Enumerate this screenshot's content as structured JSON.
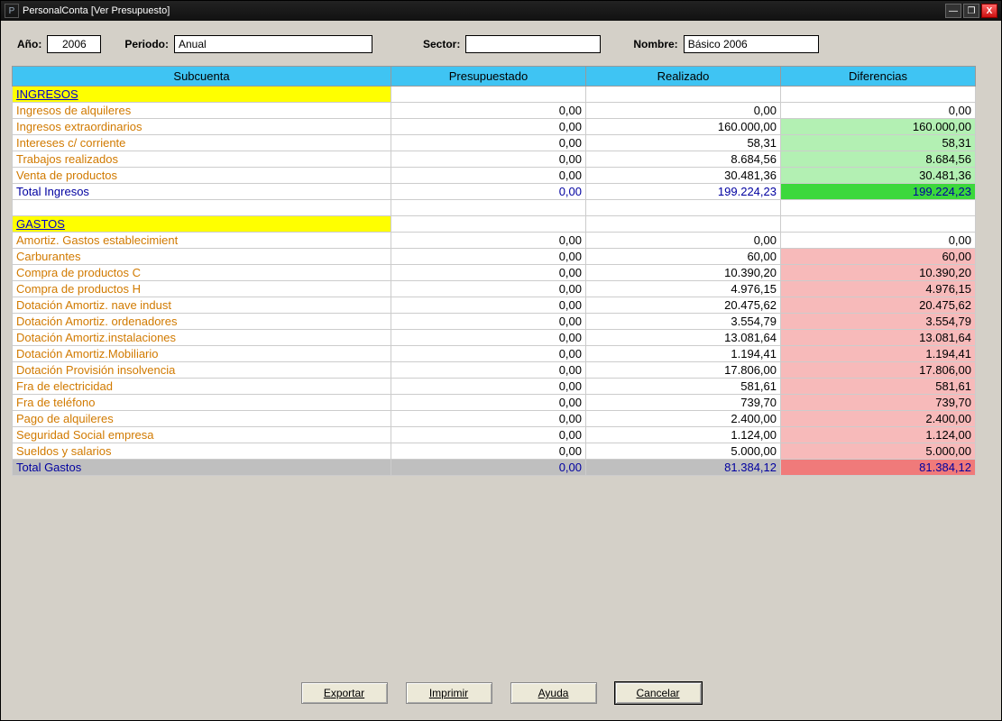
{
  "window": {
    "title": "PersonalConta [Ver Presupuesto]"
  },
  "filters": {
    "ano_label": "Año:",
    "ano_value": "2006",
    "periodo_label": "Periodo:",
    "periodo_value": "Anual",
    "sector_label": "Sector:",
    "sector_value": "",
    "nombre_label": "Nombre:",
    "nombre_value": "Básico 2006"
  },
  "columns": {
    "subcuenta": "Subcuenta",
    "presupuestado": "Presupuestado",
    "realizado": "Realizado",
    "diferencias": "Diferencias"
  },
  "sections": [
    {
      "header": "INGRESOS",
      "rows": [
        {
          "label": "Ingresos de alquileres",
          "pres": "0,00",
          "real": "0,00",
          "diff": "0,00",
          "diff_class": ""
        },
        {
          "label": "Ingresos extraordinarios",
          "pres": "0,00",
          "real": "160.000,00",
          "diff": "160.000,00",
          "diff_class": "bg-lightgreen"
        },
        {
          "label": "Intereses c/ corriente",
          "pres": "0,00",
          "real": "58,31",
          "diff": "58,31",
          "diff_class": "bg-lightgreen"
        },
        {
          "label": "Trabajos realizados",
          "pres": "0,00",
          "real": "8.684,56",
          "diff": "8.684,56",
          "diff_class": "bg-lightgreen"
        },
        {
          "label": "Venta de productos",
          "pres": "0,00",
          "real": "30.481,36",
          "diff": "30.481,36",
          "diff_class": "bg-lightgreen"
        }
      ],
      "total": {
        "label": "Total Ingresos",
        "pres": "0,00",
        "real": "199.224,23",
        "diff": "199.224,23",
        "row_class": "",
        "diff_class": "bg-green",
        "text_class": "navy"
      }
    },
    {
      "header": "GASTOS",
      "rows": [
        {
          "label": "Amortiz. Gastos establecimient",
          "pres": "0,00",
          "real": "0,00",
          "diff": "0,00",
          "diff_class": ""
        },
        {
          "label": "Carburantes",
          "pres": "0,00",
          "real": "60,00",
          "diff": "60,00",
          "diff_class": "bg-pink"
        },
        {
          "label": "Compra de productos C",
          "pres": "0,00",
          "real": "10.390,20",
          "diff": "10.390,20",
          "diff_class": "bg-pink"
        },
        {
          "label": "Compra de productos H",
          "pres": "0,00",
          "real": "4.976,15",
          "diff": "4.976,15",
          "diff_class": "bg-pink"
        },
        {
          "label": "Dotación Amortiz. nave indust",
          "pres": "0,00",
          "real": "20.475,62",
          "diff": "20.475,62",
          "diff_class": "bg-pink"
        },
        {
          "label": "Dotación Amortiz. ordenadores",
          "pres": "0,00",
          "real": "3.554,79",
          "diff": "3.554,79",
          "diff_class": "bg-pink"
        },
        {
          "label": "Dotación Amortiz.instalaciones",
          "pres": "0,00",
          "real": "13.081,64",
          "diff": "13.081,64",
          "diff_class": "bg-pink"
        },
        {
          "label": "Dotación Amortiz.Mobiliario",
          "pres": "0,00",
          "real": "1.194,41",
          "diff": "1.194,41",
          "diff_class": "bg-pink"
        },
        {
          "label": "Dotación Provisión insolvencia",
          "pres": "0,00",
          "real": "17.806,00",
          "diff": "17.806,00",
          "diff_class": "bg-pink"
        },
        {
          "label": "Fra de electricidad",
          "pres": "0,00",
          "real": "581,61",
          "diff": "581,61",
          "diff_class": "bg-pink"
        },
        {
          "label": "Fra de teléfono",
          "pres": "0,00",
          "real": "739,70",
          "diff": "739,70",
          "diff_class": "bg-pink"
        },
        {
          "label": "Pago de alquileres",
          "pres": "0,00",
          "real": "2.400,00",
          "diff": "2.400,00",
          "diff_class": "bg-pink"
        },
        {
          "label": "Seguridad Social empresa",
          "pres": "0,00",
          "real": "1.124,00",
          "diff": "1.124,00",
          "diff_class": "bg-pink"
        },
        {
          "label": "Sueldos y salarios",
          "pres": "0,00",
          "real": "5.000,00",
          "diff": "5.000,00",
          "diff_class": "bg-pink"
        }
      ],
      "total": {
        "label": "Total Gastos",
        "pres": "0,00",
        "real": "81.384,12",
        "diff": "81.384,12",
        "row_class": "bg-grey",
        "diff_class": "bg-red",
        "text_class": "navy"
      }
    }
  ],
  "buttons": {
    "exportar": "Exportar",
    "imprimir": "Imprimir",
    "ayuda": "Ayuda",
    "cancelar": "Cancelar"
  }
}
